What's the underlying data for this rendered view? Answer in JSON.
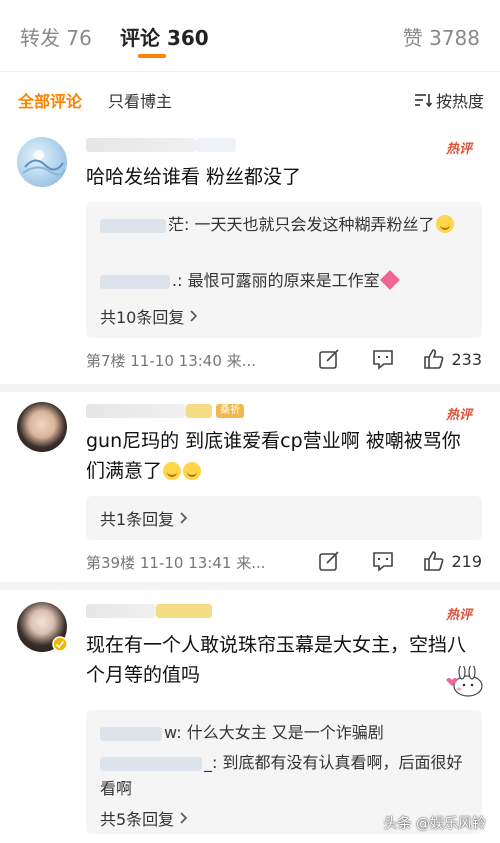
{
  "tabs": {
    "repost": "转发 76",
    "comments": "评论 360",
    "likes": "赞 3788"
  },
  "filters": {
    "all": "全部评论",
    "poster_only": "只看博主",
    "sort": "按热度"
  },
  "comments": [
    {
      "hot_label": "热评",
      "text": "哈哈发给谁看 粉丝都没了",
      "replies": [
        {
          "prefix": "茫: ",
          "text": "一天天也就只会发这种糊弄粉丝了"
        },
        {
          "prefix": ".: ",
          "text": "最恨可露丽的原来是工作室"
        }
      ],
      "more_replies": "共10条回复",
      "floor": "第7楼 11-10 13:40 来...",
      "like_count": "233"
    },
    {
      "hot_label": "热评",
      "badge": "桑祈",
      "text": "gun尼玛的 到底谁爱看cp营业啊 被嘲被骂你们满意了",
      "more_replies": "共1条回复",
      "floor": "第39楼 11-10 13:41 来...",
      "like_count": "219"
    },
    {
      "hot_label": "热评",
      "text": "现在有一个人敢说珠帘玉幕是大女主，空挡八个月等的值吗",
      "replies": [
        {
          "prefix": "w: ",
          "text": "什么大女主 又是一个诈骗剧"
        },
        {
          "prefix": "_: ",
          "text": "到底都有没有认真看啊，后面很好看啊"
        }
      ],
      "more_replies": "共5条回复"
    }
  ],
  "watermark": "头条 @娱乐风铃",
  "colors": {
    "accent": "#ff8200",
    "hot": "#e0533a"
  }
}
